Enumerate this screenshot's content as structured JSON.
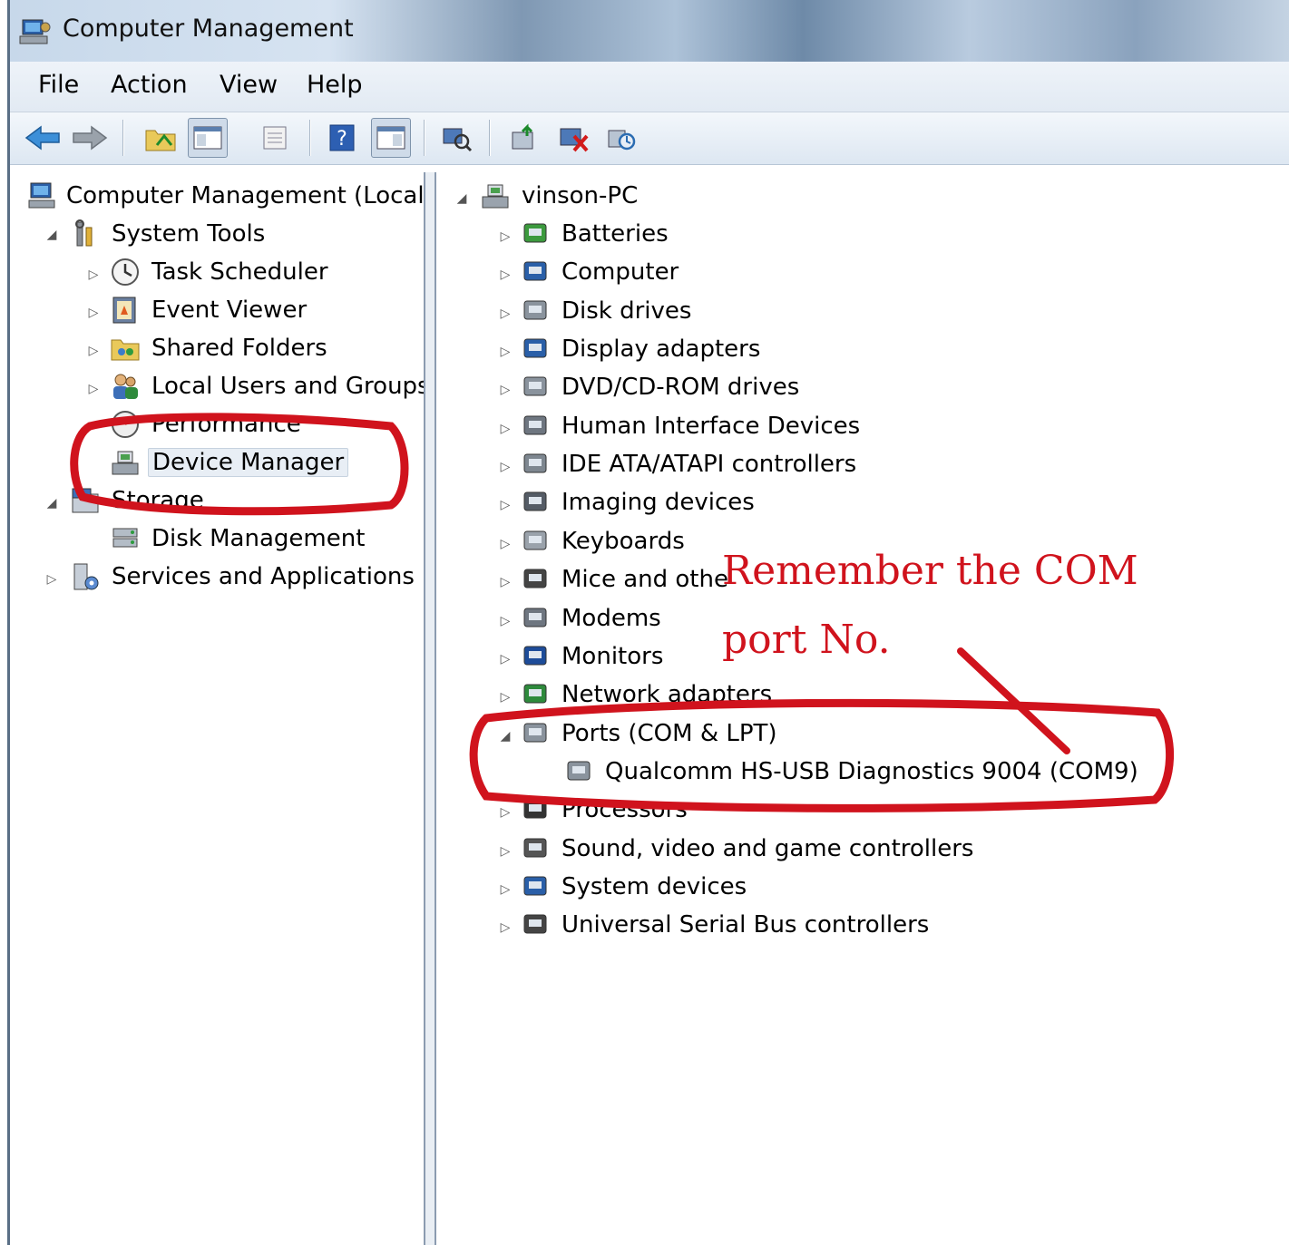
{
  "window": {
    "title": "Computer Management"
  },
  "menubar": {
    "items": [
      "File",
      "Action",
      "View",
      "Help"
    ]
  },
  "toolbar": {
    "buttons": [
      "back-arrow-icon",
      "forward-arrow-icon",
      "up-folder-icon",
      "show-hide-console-tree-icon",
      "properties-icon",
      "help-icon",
      "show-hide-action-pane-icon",
      "scan-hardware-icon",
      "update-driver-icon",
      "uninstall-icon",
      "rollback-driver-icon"
    ]
  },
  "left_tree": {
    "root": "Computer Management (Local",
    "system_tools": "System Tools",
    "task_scheduler": "Task Scheduler",
    "event_viewer": "Event Viewer",
    "shared_folders": "Shared Folders",
    "local_users": "Local Users and Groups",
    "performance": "Performance",
    "device_manager": "Device Manager",
    "storage": "Storage",
    "disk_management": "Disk Management",
    "services": "Services and Applications"
  },
  "device_tree": {
    "computer_name": "vinson-PC",
    "categories": [
      "Batteries",
      "Computer",
      "Disk drives",
      "Display adapters",
      "DVD/CD-ROM drives",
      "Human Interface Devices",
      "IDE ATA/ATAPI controllers",
      "Imaging devices",
      "Keyboards",
      "Mice and othe",
      "Modems",
      "Monitors",
      "Network adapters",
      "Ports (COM & LPT)",
      "Qualcomm HS-USB Diagnostics 9004 (COM9)",
      "Processors",
      "Sound, video and game controllers",
      "System devices",
      "Universal Serial Bus controllers"
    ]
  },
  "annotation": {
    "line1": "Remember the COM",
    "line2": "port No.",
    "color": "#d0131d"
  }
}
